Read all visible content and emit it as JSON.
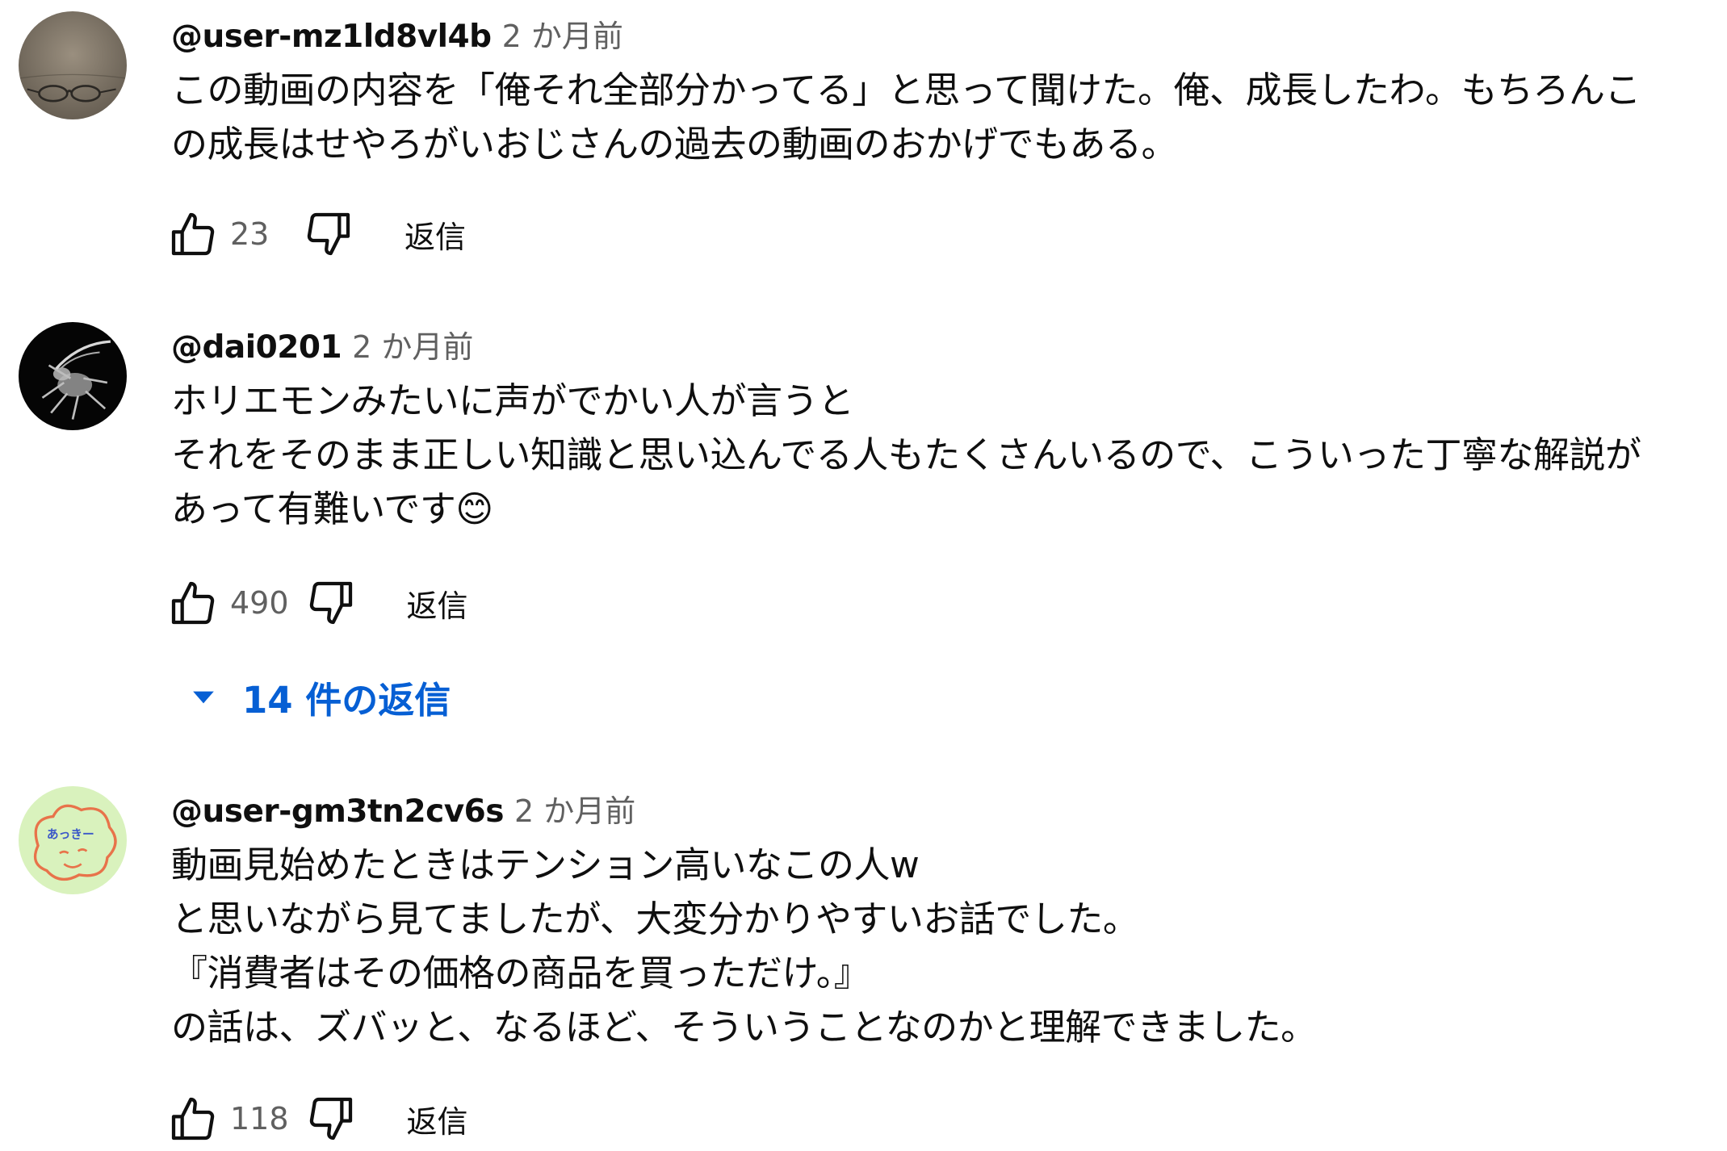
{
  "comments": [
    {
      "author": "@user-mz1ld8vl4b",
      "time": "2 か月前",
      "lines": [
        "この動画の内容を「俺それ全部分かってる」と思って聞けた。俺、成長したわ。もちろんこ",
        "の成長はせやろがいおじさんの過去の動画のおかげでもある。"
      ],
      "likes": "23",
      "reply_label": "返信",
      "avatar_icon": "glasses-photo-avatar"
    },
    {
      "author": "@dai0201",
      "time": "2 か月前",
      "lines": [
        "ホリエモンみたいに声がでかい人が言うと",
        "それをそのまま正しい知識と思い込んでる人もたくさんいるので、こういった丁寧な解説が",
        "あって有難いです😊"
      ],
      "likes": "490",
      "reply_label": "返信",
      "replies_toggle": "14 件の返信",
      "avatar_icon": "beetle-photo-avatar"
    },
    {
      "author": "@user-gm3tn2cv6s",
      "time": "2 か月前",
      "lines": [
        "動画見始めたときはテンション高いなこの人w",
        "と思いながら見てましたが、大変分かりやすいお話でした。",
        "『消費者はその価格の商品を買っただけ。』",
        "の話は、ズバッと、なるほど、そういうことなのかと理解できました。"
      ],
      "likes": "118",
      "reply_label": "返信",
      "avatar_icon": "cartoon-face-avatar"
    }
  ],
  "colors": {
    "text": "#0f0f0f",
    "secondary": "#606060",
    "link": "#065fd4"
  }
}
